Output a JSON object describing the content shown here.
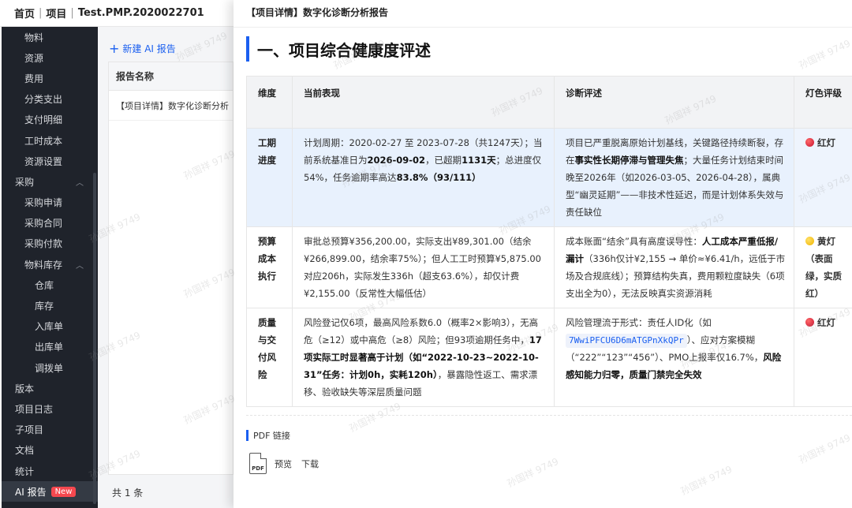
{
  "breadcrumb": {
    "home": "首页",
    "project": "项目",
    "code": "Test.PMP.2020022701"
  },
  "sidebar": {
    "items": [
      {
        "label": "物料",
        "level": 1
      },
      {
        "label": "资源",
        "level": 1
      },
      {
        "label": "费用",
        "level": 1
      },
      {
        "label": "分类支出",
        "level": 1
      },
      {
        "label": "支付明细",
        "level": 1
      },
      {
        "label": "工时成本",
        "level": 1
      },
      {
        "label": "资源设置",
        "level": 1
      },
      {
        "label": "采购",
        "level": 0,
        "expanded": true
      },
      {
        "label": "采购申请",
        "level": 1
      },
      {
        "label": "采购合同",
        "level": 1
      },
      {
        "label": "采购付款",
        "level": 1
      },
      {
        "label": "物料库存",
        "level": 1,
        "expanded": true
      },
      {
        "label": "仓库",
        "level": 2
      },
      {
        "label": "库存",
        "level": 2
      },
      {
        "label": "入库单",
        "level": 2
      },
      {
        "label": "出库单",
        "level": 2
      },
      {
        "label": "调拨单",
        "level": 2
      },
      {
        "label": "版本",
        "level": 0
      },
      {
        "label": "项目日志",
        "level": 0
      },
      {
        "label": "子项目",
        "level": 0
      },
      {
        "label": "文档",
        "level": 0
      },
      {
        "label": "统计",
        "level": 0
      },
      {
        "label": "AI 报告",
        "level": 0,
        "active": true,
        "badge": "New"
      }
    ]
  },
  "list": {
    "new_label": "新建 AI 报告",
    "header": "报告名称",
    "rows": [
      "【项目详情】数字化诊断分析"
    ],
    "count": "共 1 条"
  },
  "drawer": {
    "title": "【项目详情】数字化诊断分析报告",
    "section_title": "一、项目综合健康度评述",
    "table": {
      "headers": [
        "维度",
        "当前表现",
        "诊断评述",
        "灯色评级"
      ],
      "rows": [
        {
          "dim": "工期进度",
          "perf": [
            "计划周期：2020-02-27 至 2023-07-28（共1247天）；当前系统基准日为",
            "2026-09-02",
            "，已超期",
            "1131天",
            "；总进度仅54%，任务逾期率高达",
            "83.8%（93/111）"
          ],
          "diag": [
            "项目已严重脱离原始计划基线，关键路径持续断裂，存在",
            "事实性长期停滞与管理失焦",
            "；大量任务计划结束时间晚至2026年（如2026-03-05、2026-04-28），属典型“幽灵延期”——非技术性延迟，而是计划体系失效与责任缺位"
          ],
          "lamp": "红灯",
          "lamp_color": "red"
        },
        {
          "dim": "预算成本执行",
          "perf": [
            "审批总预算¥356,200.00，实际支出¥89,301.00（结余¥266,899.00，结余率75%）；但人工工时预算¥5,875.00对应206h，实际发生336h（超支63.6%），却仅计费¥2,155.00（反常性大幅低估）"
          ],
          "diag": [
            "成本账面“结余”具有高度误导性：",
            "人工成本严重低报/漏计",
            "（336h仅计¥2,155 → 单价≈¥6.41/h，远低于市场及合规底线）；预算结构失真，费用颗粒度缺失（6项支出全为0），无法反映真实资源消耗"
          ],
          "lamp": "黄灯（表面绿，实质红）",
          "lamp_color": "yellow"
        },
        {
          "dim": "质量与交付风险",
          "perf": [
            "风险登记仅6项，最高风险系数6.0（概率2×影响3），无高危（≥12）或中高危（≥8）风险；但93项逾期任务中，",
            "17项实际工时显著高于计划（如“2022-10-23~2022-10-31”任务：计划0h，实耗120h）",
            "，暴露隐性返工、需求漂移、验收缺失等深层质量问题"
          ],
          "diag": [
            "风险管理流于形式：责任人ID化（如",
            "7WwiPFCU6D6mATGPnXkQPr",
            "）、应对方案模糊（“222”“123”“456”）、PMO上报率仅16.7%，",
            "风险感知能力归零，质量门禁完全失效"
          ],
          "lamp": "红灯",
          "lamp_color": "red"
        }
      ]
    },
    "pdf": {
      "label": "PDF 链接",
      "icon_text": "PDF",
      "preview": "预览",
      "download": "下载"
    }
  },
  "watermark": "孙国祥 9749",
  "colors": {
    "accent": "#1a5ff0",
    "sidebar_bg": "#1f232b",
    "badge": "#f5484f",
    "highlight_row": "#e8f1fd"
  }
}
